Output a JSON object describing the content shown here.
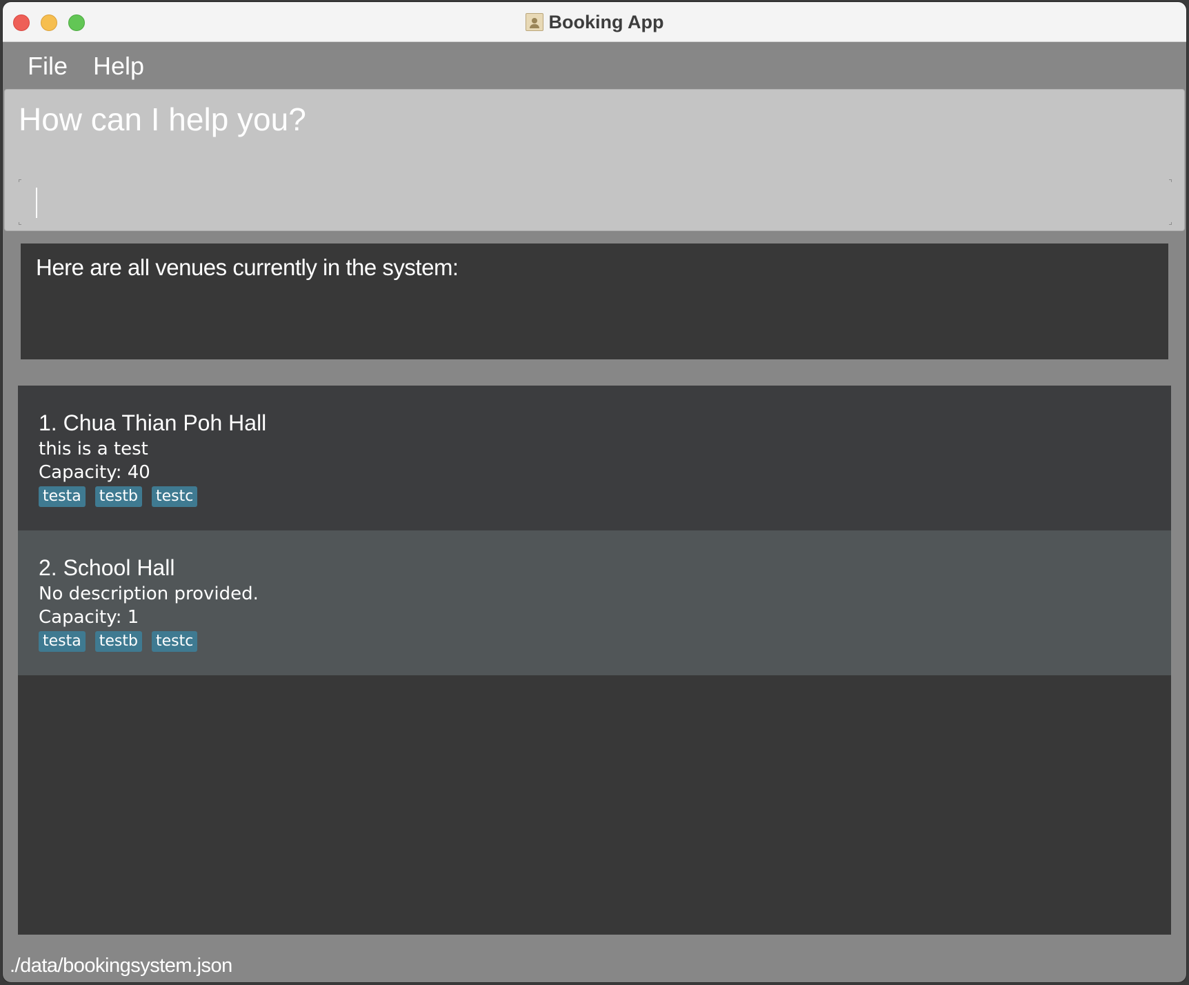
{
  "window": {
    "title": "Booking App"
  },
  "menu": {
    "file": "File",
    "help": "Help"
  },
  "command": {
    "prompt": "How can I help you?",
    "input_value": ""
  },
  "result": {
    "message": "Here are all venues currently in the system:"
  },
  "venues": [
    {
      "index_name": "1.  Chua Thian Poh Hall",
      "description": "this is a test",
      "capacity": "Capacity: 40",
      "tags": [
        "testa",
        "testb",
        "testc"
      ]
    },
    {
      "index_name": "2.  School Hall",
      "description": "No description provided.",
      "capacity": "Capacity: 1",
      "tags": [
        "testa",
        "testb",
        "testc"
      ]
    }
  ],
  "status": {
    "file_path": "./data/bookingsystem.json"
  },
  "colors": {
    "tag_bg": "#3f7a91",
    "card_odd": "#3c3d3f",
    "card_even": "#515658",
    "panel_dark": "#383838",
    "window_bg": "#878787"
  },
  "icons": {
    "app": "address-book-icon"
  }
}
